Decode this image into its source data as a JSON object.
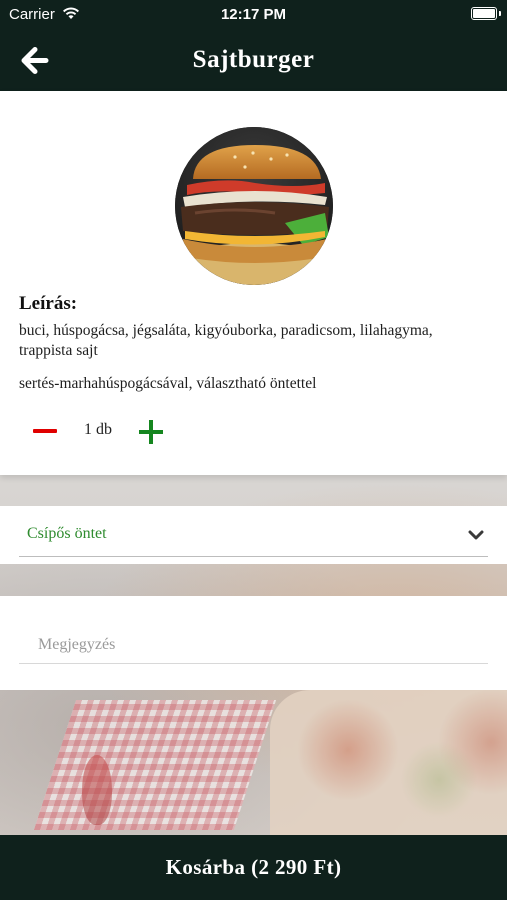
{
  "status_bar": {
    "carrier": "Carrier",
    "time": "12:17 PM",
    "wifi_icon": "wifi-icon",
    "battery_icon": "battery-icon"
  },
  "header": {
    "title": "Sajtburger",
    "back_icon": "arrow-left-icon"
  },
  "product": {
    "image": "burger-photo",
    "description_heading": "Leírás:",
    "description": "buci, húspogácsa, jégsaláta, kigyóuborka, paradicsom, lilahagyma, trappista sajt",
    "description_extra": "sertés-marhahúspogácsával, választható öntettel",
    "quantity_label": "1 db",
    "minus_color": "#e00000",
    "plus_color": "#15861f"
  },
  "sauce_select": {
    "selected": "Csípős öntet",
    "icon": "chevron-down-icon"
  },
  "note": {
    "placeholder": "Megjegyzés",
    "value": ""
  },
  "cart": {
    "label": "Kosárba (2 290 Ft)"
  },
  "colors": {
    "bar": "#0f211c",
    "accent_green": "#2e8b2e"
  }
}
